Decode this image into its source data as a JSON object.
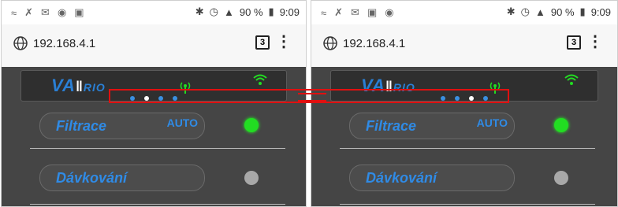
{
  "colors": {
    "accent": "#2f8be6",
    "led_on": "#22dd22",
    "led_off": "#a8a8a8",
    "highlight": "#e01010",
    "app_bg": "#454545"
  },
  "panels": [
    {
      "status": {
        "battery": "90 %",
        "time": "9:09"
      },
      "address": {
        "url": "192.168.4.1",
        "tabs": "3"
      },
      "app": {
        "logo": "VA",
        "logo_tail": "RIO",
        "pagination_active": 1,
        "rows": [
          {
            "label": "Filtrace",
            "mode": "AUTO",
            "led": "on"
          },
          {
            "label": "Dávkování",
            "mode": "",
            "led": "off"
          }
        ]
      }
    },
    {
      "status": {
        "battery": "90 %",
        "time": "9:09"
      },
      "address": {
        "url": "192.168.4.1",
        "tabs": "3"
      },
      "app": {
        "logo": "VA",
        "logo_tail": "RIO",
        "pagination_active": 2,
        "rows": [
          {
            "label": "Filtrace",
            "mode": "AUTO",
            "led": "on"
          },
          {
            "label": "Dávkování",
            "mode": "",
            "led": "off"
          }
        ]
      }
    }
  ]
}
